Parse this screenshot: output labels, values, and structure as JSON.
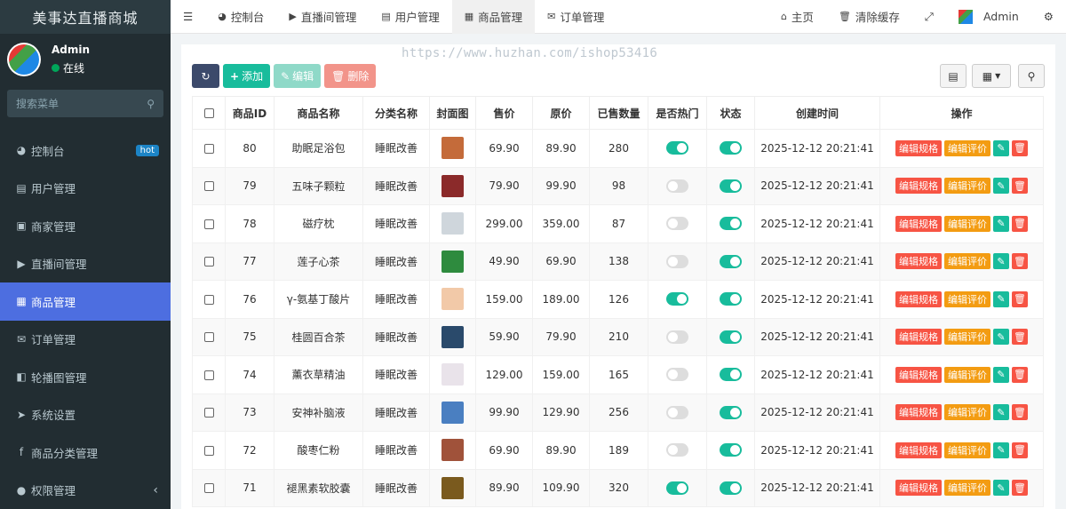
{
  "app": {
    "title": "美事达直播商城"
  },
  "user": {
    "name": "Admin",
    "status": "在线"
  },
  "sidebar": {
    "search_placeholder": "搜索菜单",
    "items": [
      {
        "label": "控制台",
        "icon": "dashboard-icon",
        "badge": "hot"
      },
      {
        "label": "用户管理",
        "icon": "id-card-icon"
      },
      {
        "label": "商家管理",
        "icon": "contact-icon"
      },
      {
        "label": "直播间管理",
        "icon": "video-icon"
      },
      {
        "label": "商品管理",
        "icon": "image-icon",
        "active": true
      },
      {
        "label": "订单管理",
        "icon": "envelope-icon"
      },
      {
        "label": "轮播图管理",
        "icon": "carousel-icon"
      },
      {
        "label": "系统设置",
        "icon": "paper-plane-icon"
      },
      {
        "label": "商品分类管理",
        "icon": "facebook-icon"
      },
      {
        "label": "权限管理",
        "icon": "users-icon"
      }
    ]
  },
  "topnav": {
    "tabs": [
      {
        "label": "控制台",
        "icon": "dashboard-icon"
      },
      {
        "label": "直播间管理",
        "icon": "video-icon"
      },
      {
        "label": "用户管理",
        "icon": "id-card-icon"
      },
      {
        "label": "商品管理",
        "icon": "image-icon",
        "active": true
      },
      {
        "label": "订单管理",
        "icon": "envelope-icon"
      }
    ],
    "home": "主页",
    "clear_cache": "清除缓存",
    "admin": "Admin"
  },
  "watermark": "https://www.huzhan.com/ishop53416",
  "toolbar": {
    "add": "添加",
    "edit": "编辑",
    "delete": "删除"
  },
  "table": {
    "headers": [
      "商品ID",
      "商品名称",
      "分类名称",
      "封面图",
      "售价",
      "原价",
      "已售数量",
      "是否热门",
      "状态",
      "创建时间",
      "操作"
    ],
    "op_spec": "编辑规格",
    "op_review": "编辑评价",
    "rows": [
      {
        "id": "80",
        "name": "助眠足浴包",
        "category": "睡眠改善",
        "price": "69.90",
        "original": "89.90",
        "sold": "280",
        "hot": true,
        "status": true,
        "created": "2025-12-12 20:21:41",
        "cover_color": "#c46b3a"
      },
      {
        "id": "79",
        "name": "五味子颗粒",
        "category": "睡眠改善",
        "price": "79.90",
        "original": "99.90",
        "sold": "98",
        "hot": false,
        "status": true,
        "created": "2025-12-12 20:21:41",
        "cover_color": "#8b2a2a"
      },
      {
        "id": "78",
        "name": "磁疗枕",
        "category": "睡眠改善",
        "price": "299.00",
        "original": "359.00",
        "sold": "87",
        "hot": false,
        "status": true,
        "created": "2025-12-12 20:21:41",
        "cover_color": "#cfd6dc"
      },
      {
        "id": "77",
        "name": "莲子心茶",
        "category": "睡眠改善",
        "price": "49.90",
        "original": "69.90",
        "sold": "138",
        "hot": false,
        "status": true,
        "created": "2025-12-12 20:21:41",
        "cover_color": "#2e8b3e"
      },
      {
        "id": "76",
        "name": "γ-氨基丁酸片",
        "category": "睡眠改善",
        "price": "159.00",
        "original": "189.00",
        "sold": "126",
        "hot": true,
        "status": true,
        "created": "2025-12-12 20:21:41",
        "cover_color": "#f2c9a8"
      },
      {
        "id": "75",
        "name": "桂圆百合茶",
        "category": "睡眠改善",
        "price": "59.90",
        "original": "79.90",
        "sold": "210",
        "hot": false,
        "status": true,
        "created": "2025-12-12 20:21:41",
        "cover_color": "#2a4a6b"
      },
      {
        "id": "74",
        "name": "薰衣草精油",
        "category": "睡眠改善",
        "price": "129.00",
        "original": "159.00",
        "sold": "165",
        "hot": false,
        "status": true,
        "created": "2025-12-12 20:21:41",
        "cover_color": "#e9e3ea"
      },
      {
        "id": "73",
        "name": "安神补脑液",
        "category": "睡眠改善",
        "price": "99.90",
        "original": "129.90",
        "sold": "256",
        "hot": false,
        "status": true,
        "created": "2025-12-12 20:21:41",
        "cover_color": "#4a7fc1"
      },
      {
        "id": "72",
        "name": "酸枣仁粉",
        "category": "睡眠改善",
        "price": "69.90",
        "original": "89.90",
        "sold": "189",
        "hot": false,
        "status": true,
        "created": "2025-12-12 20:21:41",
        "cover_color": "#a0523a"
      },
      {
        "id": "71",
        "name": "褪黑素软胶囊",
        "category": "睡眠改善",
        "price": "89.90",
        "original": "109.90",
        "sold": "320",
        "hot": true,
        "status": true,
        "created": "2025-12-12 20:21:41",
        "cover_color": "#7a5a1e"
      }
    ]
  }
}
